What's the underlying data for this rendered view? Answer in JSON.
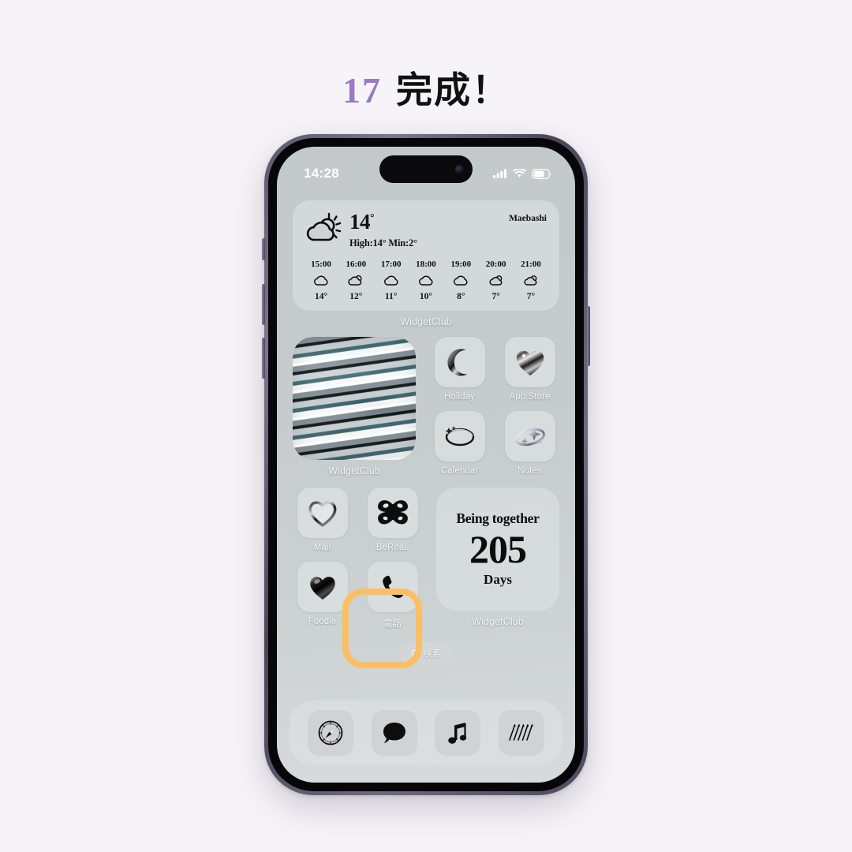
{
  "title": {
    "number": "17",
    "text": "完成！",
    "accent_color": "#9a7ac4"
  },
  "page": {
    "background_color": "#f6f4f8"
  },
  "phone": {
    "frame_color": "#5d566b",
    "wallpaper_color": "#c6cbcd",
    "status_bar": {
      "time": "14:28",
      "signal_icon": "cellular-signal-icon",
      "wifi_icon": "wifi-icon",
      "battery_icon": "battery-icon"
    },
    "dynamic_island": {
      "camera_icon": "front-camera-icon"
    }
  },
  "weather_widget": {
    "condition_icon": "sun-behind-cloud-icon",
    "current_temp": "14",
    "degree": "°",
    "high_low": "High:14° Min:2°",
    "city": "Maebashi",
    "hours": [
      {
        "time": "15:00",
        "icon": "cloud-icon",
        "temp": "14°"
      },
      {
        "time": "16:00",
        "icon": "sun-behind-cloud-icon",
        "temp": "12°"
      },
      {
        "time": "17:00",
        "icon": "cloud-icon",
        "temp": "11°"
      },
      {
        "time": "18:00",
        "icon": "cloud-icon",
        "temp": "10°"
      },
      {
        "time": "19:00",
        "icon": "cloud-icon",
        "temp": "8°"
      },
      {
        "time": "20:00",
        "icon": "sun-behind-cloud-icon",
        "temp": "7°"
      },
      {
        "time": "21:00",
        "icon": "sun-behind-cloud-icon",
        "temp": "7°"
      }
    ],
    "footer_label": "WidgetClub"
  },
  "photo_widget": {
    "label": "WidgetClub",
    "icon": "marble-texture-widget"
  },
  "counter_widget": {
    "top_text": "Being together",
    "number": "205",
    "bottom_text": "Days",
    "footer_label": "WidgetClub"
  },
  "apps": {
    "holiday": {
      "label": "Holiday",
      "icon": "crescent-moon-icon"
    },
    "appstore": {
      "label": "App Store",
      "icon": "chrome-heart-icon"
    },
    "calendar": {
      "label": "Calendar",
      "icon": "ring-ellipse-icon"
    },
    "notes": {
      "label": "Notes",
      "icon": "sparkle-ring-icon"
    },
    "mail": {
      "label": "Mail",
      "icon": "outline-heart-icon"
    },
    "bereal": {
      "label": "BeReal.",
      "icon": "butterfly-icon"
    },
    "foodie": {
      "label": "Foodie",
      "icon": "black-heart-icon"
    },
    "phone": {
      "label": "電話",
      "icon": "phone-handset-icon",
      "highlighted": true
    }
  },
  "highlight": {
    "color": "#fbbf63"
  },
  "search": {
    "label": "検索",
    "icon": "search-icon"
  },
  "dock": [
    {
      "name": "safari",
      "icon": "compass-icon"
    },
    {
      "name": "messages",
      "icon": "speech-bubble-icon"
    },
    {
      "name": "music",
      "icon": "music-note-icon"
    },
    {
      "name": "camera",
      "icon": "strikes-icon"
    }
  ]
}
